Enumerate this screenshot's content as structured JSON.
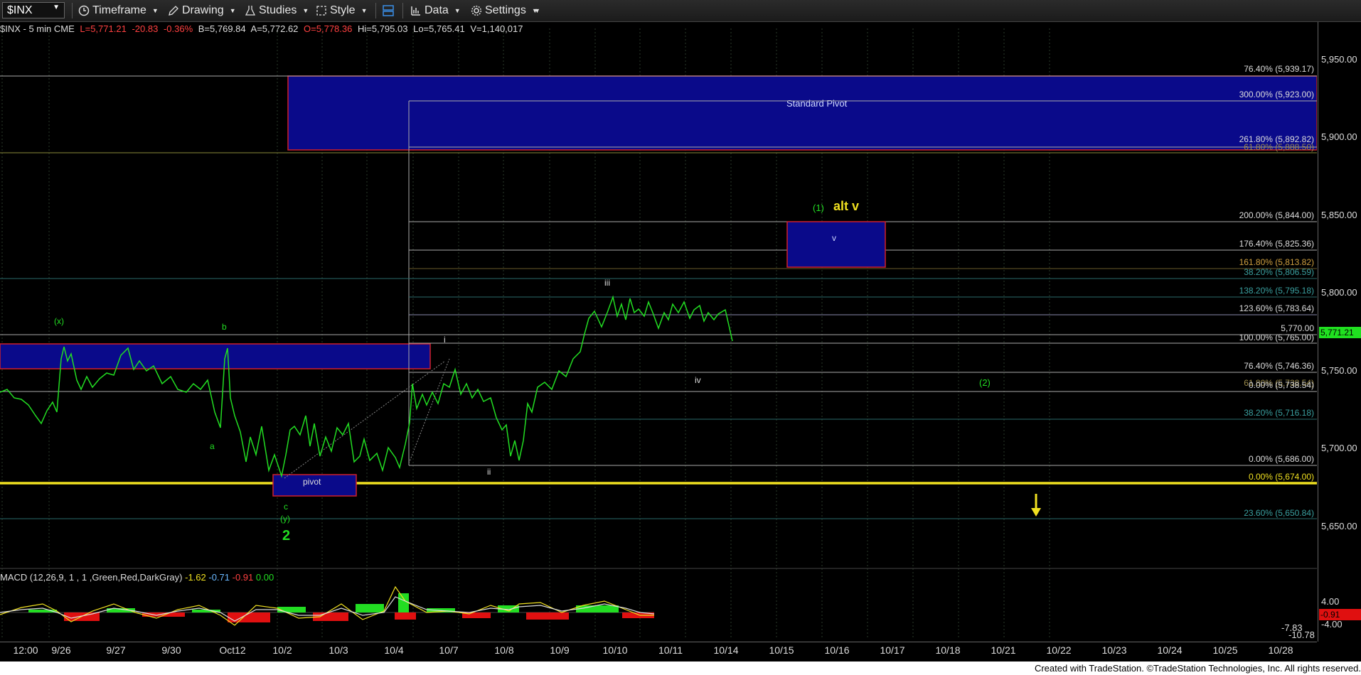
{
  "toolbar": {
    "symbol": "$INX",
    "timeframe": "Timeframe",
    "drawing": "Drawing",
    "studies": "Studies",
    "style": "Style",
    "data": "Data",
    "settings": "Settings"
  },
  "info": {
    "name": "$INX - 5 min  CME",
    "last": "L=5,771.21",
    "change": "-20.83",
    "pct": "-0.36%",
    "bid": "B=5,769.84",
    "ask": "A=5,772.62",
    "open": "O=5,778.36",
    "hi": "Hi=5,795.03",
    "lo": "Lo=5,765.41",
    "vol": "V=1,140,017"
  },
  "price_axis": {
    "ticks": [
      "5,950.00",
      "5,900.00",
      "5,850.00",
      "5,800.00",
      "5,750.00",
      "5,700.00",
      "5,650.00"
    ],
    "current": "5,771.21",
    "macd_ticks": [
      "4.00",
      "-4.00",
      "-7.83",
      "-10.78"
    ],
    "macd_current": "-0.91"
  },
  "time_axis": [
    "12:00",
    "9/26",
    "9/27",
    "9/30",
    "Oct12",
    "10/2",
    "10/3",
    "10/4",
    "10/7",
    "10/8",
    "10/9",
    "10/10",
    "10/11",
    "10/14",
    "10/15",
    "10/16",
    "10/17",
    "10/18",
    "10/21",
    "10/22",
    "10/23",
    "10/24",
    "10/25",
    "10/28"
  ],
  "fib_labels": {
    "f1": "76.40% (5,939.17)",
    "f2": "300.00% (5,923.00)",
    "f3": "261.80% (5,892.82)",
    "f3b": "61.80% (5,888.50)",
    "f4": "200.00% (5,844.00)",
    "f5": "176.40% (5,825.36)",
    "f6": "161.80% (5,813.82)",
    "f7": "38.20% (5,806.59)",
    "f8": "138.20% (5,795.18)",
    "f9": "123.60% (5,783.64)",
    "f10": "5,770.00",
    "f11": "100.00% (5,765.00)",
    "f12": "76.40% (5,746.36)",
    "f13": "61.80% (5,738.54)",
    "f13b": "0.00% (5,738.54)",
    "f14": "38.20% (5,716.18)",
    "f15": "0.00% (5,686.00)",
    "f16": "0.00% (5,674.00)",
    "f17": "23.60% (5,650.84)"
  },
  "annotations": {
    "standard_pivot": "Standard Pivot",
    "pivot": "pivot",
    "wave_x": "(x)",
    "wave_b": "b",
    "wave_a": "a",
    "wave_c": "c",
    "wave_y": "(y)",
    "wave_2": "2",
    "wave_i": "i",
    "wave_ii": "ii",
    "wave_iii": "iii",
    "wave_iv": "iv",
    "wave_v": "v",
    "wave_1p": "(1)",
    "alt_v": "alt v",
    "wave_2p": "(2)"
  },
  "macd": {
    "label": "MACD (12,26,9, 1 , 1 ,Green,Red,DarkGray)",
    "v1": "-1.62",
    "v2": "-0.71",
    "v3": "-0.91",
    "v4": "0.00"
  },
  "footer": "Created with TradeStation. ©TradeStation Technologies, Inc. All rights reserved.",
  "colors": {
    "price_line": "#22dd22",
    "box_fill": "#0a0a8a",
    "box_border": "#d0202a",
    "support_line": "#f0e020",
    "fib_line": "#bbbbbb"
  }
}
